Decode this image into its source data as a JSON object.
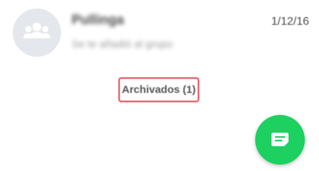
{
  "chat": {
    "name": "Pullinga",
    "preview": "Se te añadió al grupo",
    "date": "1/12/16",
    "avatar_icon": "group-icon"
  },
  "archived": {
    "label": "Archivados (1)",
    "highlight_color": "#d9424d"
  },
  "fab": {
    "icon": "new-chat-icon",
    "color": "#1cd160"
  }
}
